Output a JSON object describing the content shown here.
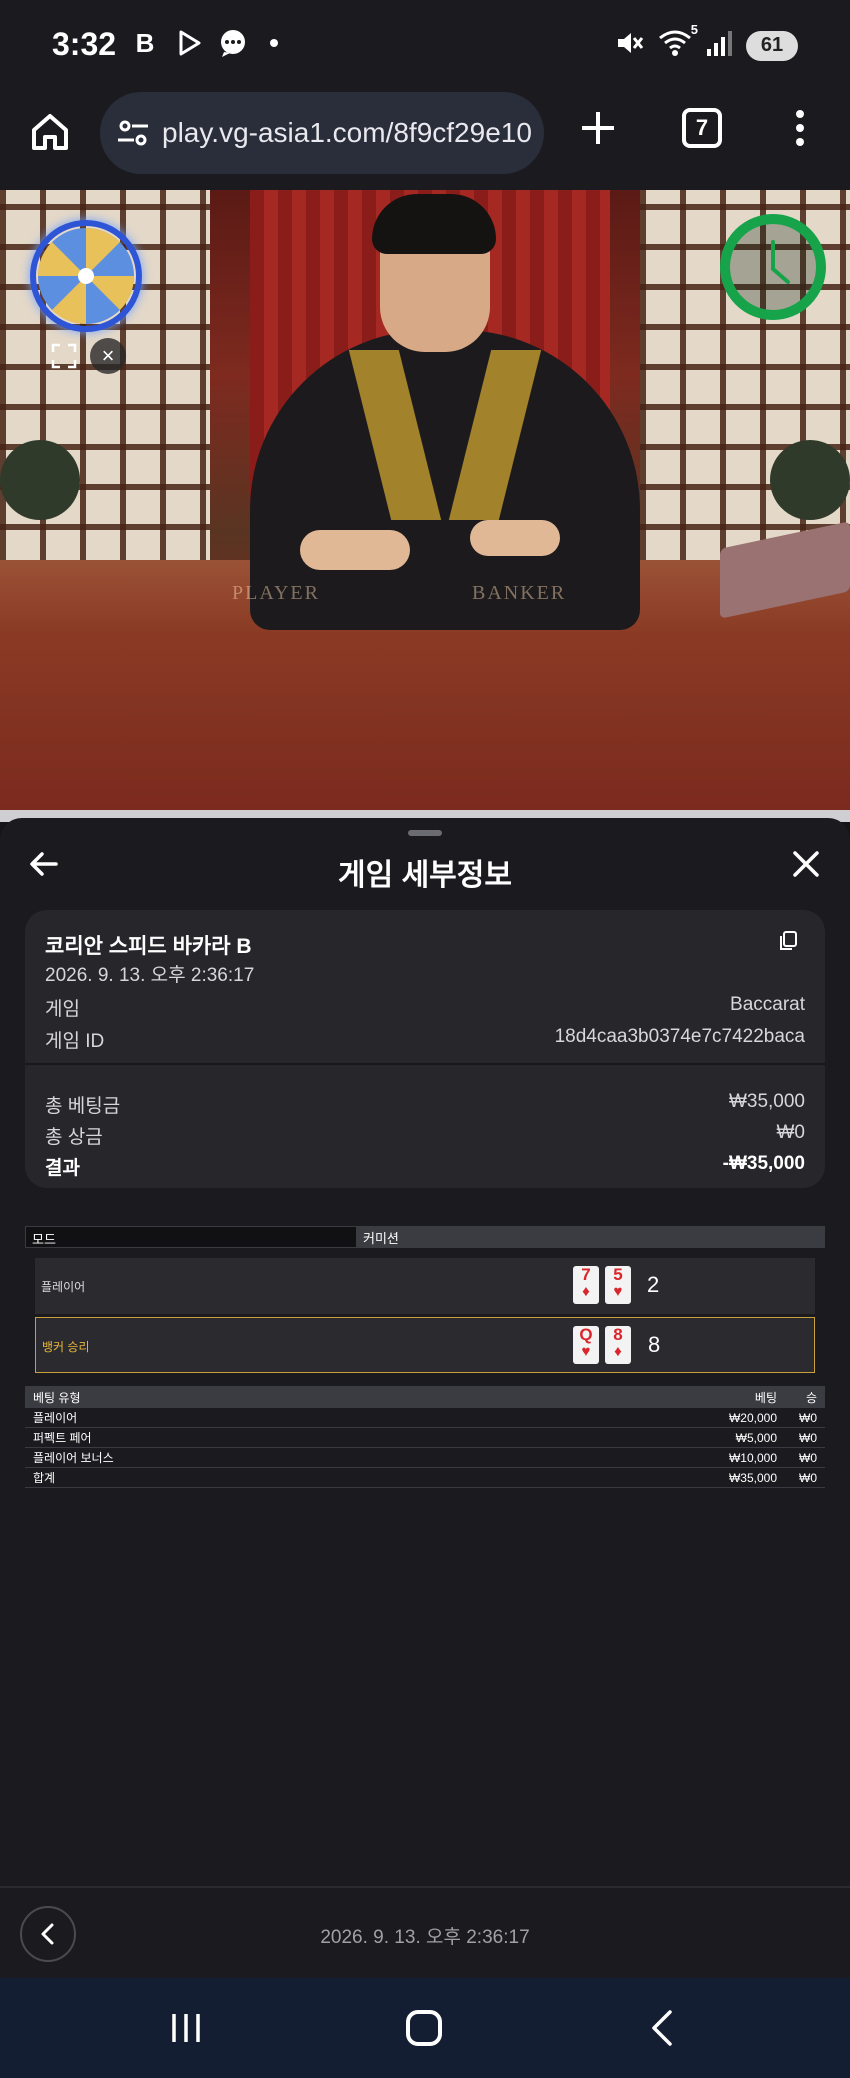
{
  "status_bar": {
    "time": "3:32",
    "app_icons": [
      "b-icon",
      "play-store-icon",
      "messages-icon"
    ],
    "wifi_label": "5",
    "battery": "61"
  },
  "browser": {
    "url": "play.vg-asia1.com/8f9cf29e10",
    "tab_count": "7"
  },
  "video": {
    "table_left": "PLAYER",
    "table_right": "BANKER"
  },
  "sheet": {
    "title": "게임 세부정보",
    "game_name": "코리안 스피드 바카라 B",
    "datetime": "2026. 9. 13. 오후 2:36:17",
    "rows": [
      {
        "label": "게임",
        "value": "Baccarat"
      },
      {
        "label": "게임 ID",
        "value": "18d4caa3b0374e7c7422baca"
      }
    ],
    "totals": [
      {
        "label": "총 베팅금",
        "value": "₩35,000"
      },
      {
        "label": "총 상금",
        "value": "₩0"
      },
      {
        "label": "결과",
        "value": "-₩35,000"
      }
    ],
    "mode_header": {
      "mode": "모드",
      "commission": "커미션"
    },
    "hands": [
      {
        "label": "플레이어",
        "cards": [
          {
            "rank": "7",
            "suit": "♦"
          },
          {
            "rank": "5",
            "suit": "♥"
          }
        ],
        "score": "2"
      },
      {
        "label": "뱅커 승리",
        "cards": [
          {
            "rank": "Q",
            "suit": "♥"
          },
          {
            "rank": "8",
            "suit": "♦"
          }
        ],
        "score": "8"
      }
    ],
    "bet_header": {
      "type": "베팅 유형",
      "bet": "베팅",
      "win": "승"
    },
    "bets": [
      {
        "type": "플레이어",
        "bet": "₩20,000",
        "win": "₩0"
      },
      {
        "type": "퍼펙트 페어",
        "bet": "₩5,000",
        "win": "₩0"
      },
      {
        "type": "플레이어 보너스",
        "bet": "₩10,000",
        "win": "₩0"
      },
      {
        "type": "합계",
        "bet": "₩35,000",
        "win": "₩0"
      }
    ],
    "footer_datetime": "2026. 9. 13. 오후 2:36:17"
  }
}
